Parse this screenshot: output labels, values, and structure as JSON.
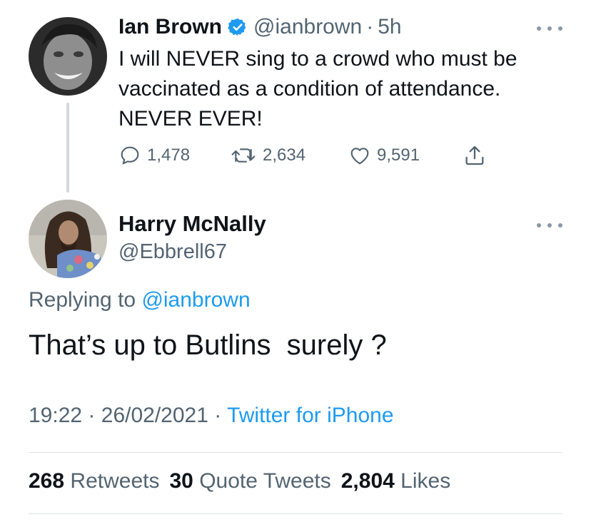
{
  "parent_tweet": {
    "author_name": "Ian Brown",
    "verified_icon": "verified-badge-icon",
    "handle": "@ianbrown",
    "separator": "·",
    "time": "5h",
    "text": "I will NEVER sing to a crowd who must be\nvaccinated as a condition of attendance.\nNEVER EVER!",
    "actions": {
      "replies": "1,478",
      "retweets": "2,634",
      "likes": "9,591"
    }
  },
  "reply_tweet": {
    "author_name": "Harry McNally",
    "handle": "@Ebbrell67",
    "replying_prefix": "Replying to",
    "replying_to": "@ianbrown",
    "text": "That’s up to Butlins  surely ?",
    "time": "19:22",
    "date": "26/02/2021",
    "sep1": "·",
    "sep2": "·",
    "source": "Twitter for iPhone",
    "stats": {
      "retweets_count": "268",
      "retweets_label": "Retweets",
      "quotes_count": "30",
      "quotes_label": "Quote Tweets",
      "likes_count": "2,804",
      "likes_label": "Likes"
    }
  },
  "colors": {
    "accent": "#1d9bf0",
    "secondary_text": "#536471",
    "primary_text": "#0f1419"
  }
}
